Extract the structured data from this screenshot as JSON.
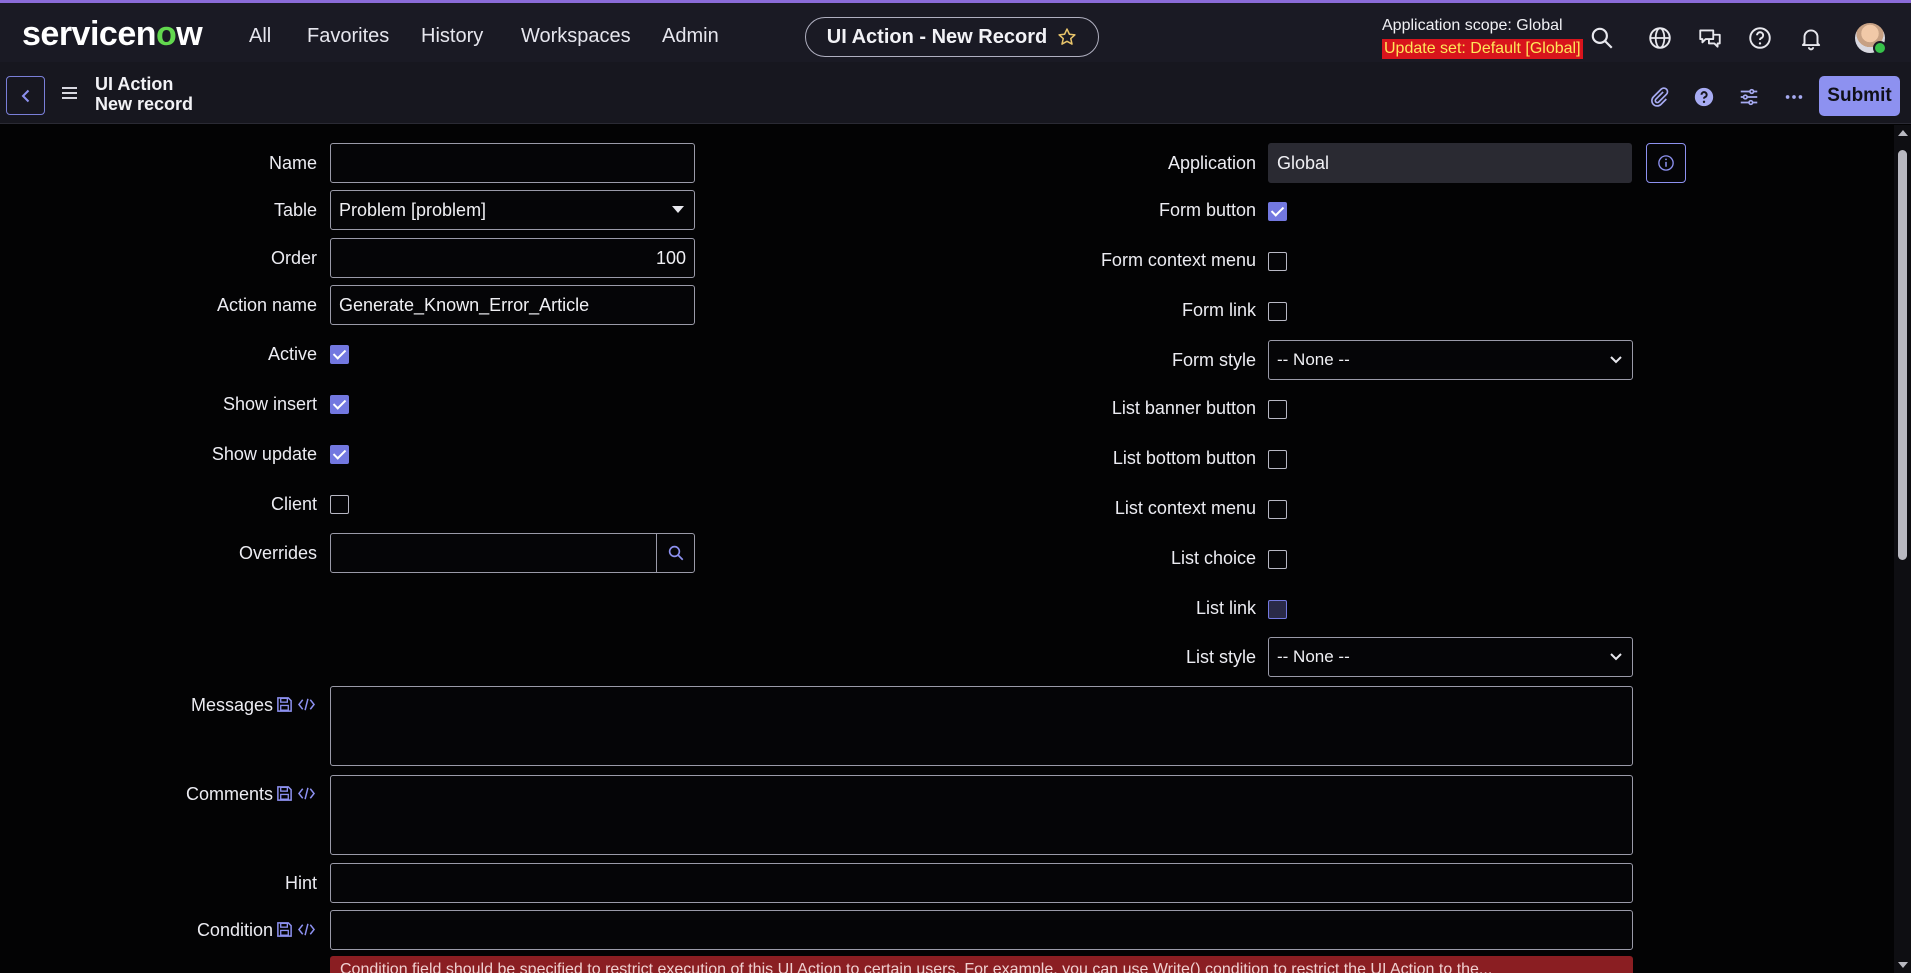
{
  "header": {
    "logo": {
      "prefix": "servicen",
      "o": "o",
      "suffix": "w"
    },
    "nav": [
      "All",
      "Favorites",
      "History",
      "Workspaces",
      "Admin"
    ],
    "record_pill": "UI Action - New Record",
    "scope": "Application scope: Global",
    "update_set": "Update set: Default [Global]",
    "icons": [
      "search-icon",
      "globe-icon",
      "chat-icon",
      "help-icon",
      "bell-icon",
      "avatar"
    ]
  },
  "subheader": {
    "title_line1": "UI Action",
    "title_line2": "New record",
    "submit_label": "Submit",
    "icons": [
      "attachment-icon",
      "help-circle-icon",
      "settings-sliders-icon",
      "more-icon"
    ]
  },
  "form": {
    "left": {
      "name": {
        "label": "Name",
        "value": ""
      },
      "table": {
        "label": "Table",
        "value": "Problem [problem]"
      },
      "order": {
        "label": "Order",
        "value": "100"
      },
      "action_name": {
        "label": "Action name",
        "value": "Generate_Known_Error_Article"
      },
      "active": {
        "label": "Active",
        "checked": true
      },
      "show_insert": {
        "label": "Show insert",
        "checked": true
      },
      "show_update": {
        "label": "Show update",
        "checked": true
      },
      "client": {
        "label": "Client",
        "checked": false
      },
      "overrides": {
        "label": "Overrides",
        "value": ""
      }
    },
    "right": {
      "application": {
        "label": "Application",
        "value": "Global"
      },
      "form_button": {
        "label": "Form button",
        "checked": true
      },
      "form_context_menu": {
        "label": "Form context menu",
        "checked": false
      },
      "form_link": {
        "label": "Form link",
        "checked": false
      },
      "form_style": {
        "label": "Form style",
        "value": "-- None --"
      },
      "list_banner_button": {
        "label": "List banner button",
        "checked": false
      },
      "list_bottom_button": {
        "label": "List bottom button",
        "checked": false
      },
      "list_context_menu": {
        "label": "List context menu",
        "checked": false
      },
      "list_choice": {
        "label": "List choice",
        "checked": false
      },
      "list_link": {
        "label": "List link",
        "checked": false
      },
      "list_style": {
        "label": "List style",
        "value": "-- None --"
      }
    },
    "full": {
      "messages": {
        "label": "Messages",
        "value": ""
      },
      "comments": {
        "label": "Comments",
        "value": ""
      },
      "hint": {
        "label": "Hint",
        "value": ""
      },
      "condition": {
        "label": "Condition",
        "value": ""
      }
    },
    "error_text": "Condition field should be specified to restrict execution of this UI Action to certain users. For example, you can use Write() condition to restrict the UI Action to the..."
  },
  "colors": {
    "accent": "#8d91f0",
    "brand_green": "#62d84e",
    "update_set_bg": "#d8141c",
    "update_set_fg": "#ffe65a"
  }
}
